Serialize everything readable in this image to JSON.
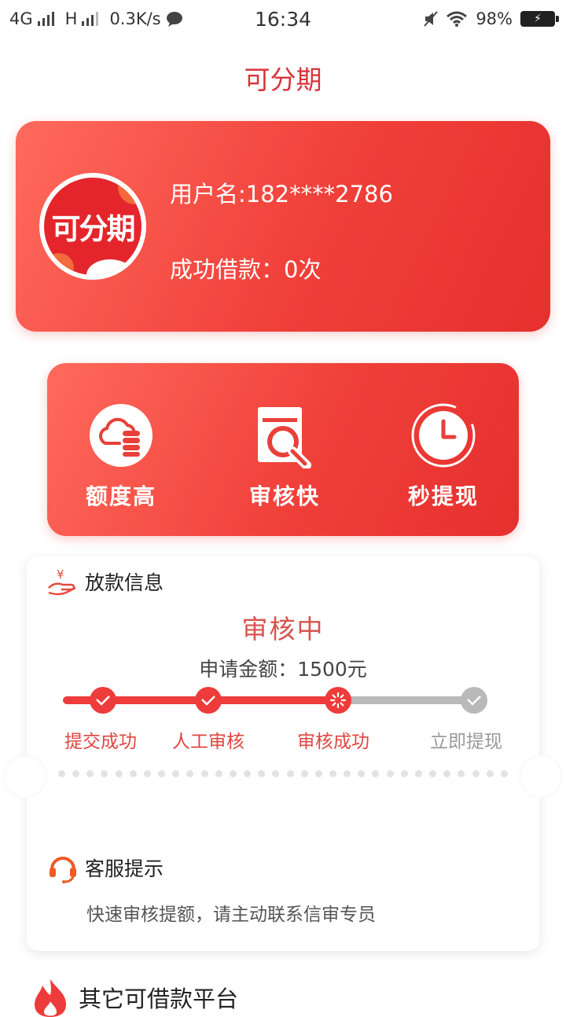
{
  "status_bar": {
    "network1": "4G",
    "network2": "H",
    "speed": "0.3K/s",
    "time": "16:34",
    "battery": "98%"
  },
  "page": {
    "title": "可分期"
  },
  "user_card": {
    "avatar_logo": "可分期",
    "username": "用户名:182****2786",
    "loans": "成功借款：0次"
  },
  "features": [
    {
      "label": "额度高",
      "icon": "cloud-coins-icon"
    },
    {
      "label": "审核快",
      "icon": "document-search-icon"
    },
    {
      "label": "秒提现",
      "icon": "clock-icon"
    }
  ],
  "loan_info": {
    "heading": "放款信息",
    "status": "审核中",
    "apply_amount": "申请金额：1500元",
    "steps": [
      {
        "label": "提交成功",
        "state": "done"
      },
      {
        "label": "人工审核",
        "state": "done"
      },
      {
        "label": "审核成功",
        "state": "current"
      },
      {
        "label": "立即提现",
        "state": "pending"
      }
    ],
    "progress": 0.6
  },
  "customer_service": {
    "heading": "客服提示",
    "text": "快速审核提额，请主动联系信审专员"
  },
  "other_platforms": {
    "heading": "其它可借款平台"
  },
  "colors": {
    "accent": "#ee3b3b",
    "inactive": "#b9b9b9",
    "title": "#d9343a"
  }
}
